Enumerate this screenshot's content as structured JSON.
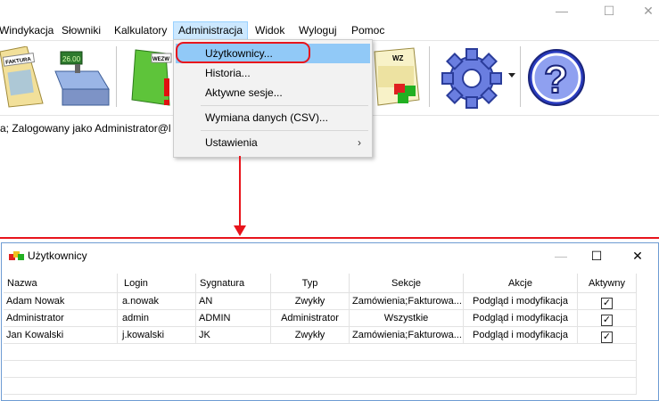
{
  "menubar": {
    "items": [
      "Windykacja",
      "Słowniki",
      "Kalkulatory",
      "Administracja",
      "Widok",
      "Wyloguj",
      "Pomoc"
    ]
  },
  "toolbar": {
    "faktura_label": "FAKTURA",
    "register_amount": "26.00",
    "wezw_label": "WEZW",
    "wz_label": "WZ"
  },
  "status": {
    "text": "a;  Zalogowany jako Administrator@l"
  },
  "admin_menu": {
    "items": [
      {
        "label": "Użytkownicy..."
      },
      {
        "label": "Historia..."
      },
      {
        "label": "Aktywne sesje..."
      },
      {
        "label": "Wymiana danych (CSV)..."
      },
      {
        "label": "Ustawienia"
      }
    ],
    "submenu_arrow": "›"
  },
  "users_window": {
    "title": "Użytkownicy",
    "columns": [
      "Nazwa",
      "Login",
      "Sygnatura",
      "Typ",
      "Sekcje",
      "Akcje",
      "Aktywny"
    ],
    "rows": [
      {
        "nazwa": "Adam Nowak",
        "login": "a.nowak",
        "sygnatura": "AN",
        "typ": "Zwykły",
        "sekcje": "Zamówienia;Fakturowa...",
        "akcje": "Podgląd i modyfikacja",
        "aktywny": "✓"
      },
      {
        "nazwa": "Administrator",
        "login": "admin",
        "sygnatura": "ADMIN",
        "typ": "Administrator",
        "sekcje": "Wszystkie",
        "akcje": "Podgląd i modyfikacja",
        "aktywny": "✓"
      },
      {
        "nazwa": "Jan Kowalski",
        "login": "j.kowalski",
        "sygnatura": "JK",
        "typ": "Zwykły",
        "sekcje": "Zamówienia;Fakturowa...",
        "akcje": "Podgląd i modyfikacja",
        "aktywny": "✓"
      }
    ]
  },
  "colors": {
    "highlight_ring": "#e8141c",
    "menu_highlight": "#91c9f7"
  }
}
